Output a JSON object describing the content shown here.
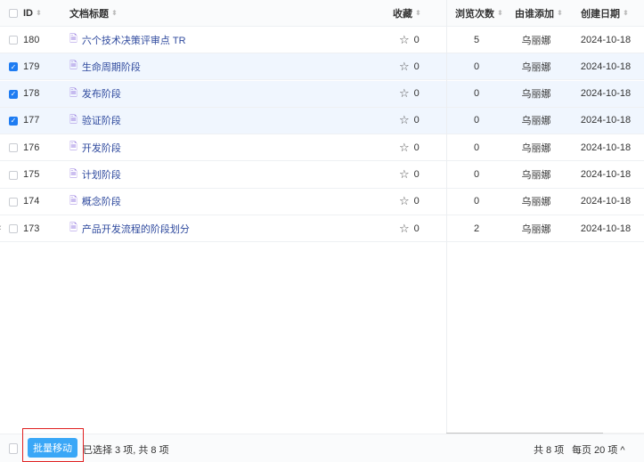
{
  "columns": {
    "id": "ID",
    "title": "文档标题",
    "fav": "收藏",
    "views": "浏览次数",
    "by": "由谁添加",
    "date": "创建日期"
  },
  "rows": [
    {
      "id": "180",
      "title": "六个技术决策评审点 TR",
      "fav": "0",
      "views": "5",
      "by": "乌丽娜",
      "date": "2024-10-18",
      "checked": false
    },
    {
      "id": "179",
      "title": "生命周期阶段",
      "fav": "0",
      "views": "0",
      "by": "乌丽娜",
      "date": "2024-10-18",
      "checked": true
    },
    {
      "id": "178",
      "title": "发布阶段",
      "fav": "0",
      "views": "0",
      "by": "乌丽娜",
      "date": "2024-10-18",
      "checked": true
    },
    {
      "id": "177",
      "title": "验证阶段",
      "fav": "0",
      "views": "0",
      "by": "乌丽娜",
      "date": "2024-10-18",
      "checked": true
    },
    {
      "id": "176",
      "title": "开发阶段",
      "fav": "0",
      "views": "0",
      "by": "乌丽娜",
      "date": "2024-10-18",
      "checked": false
    },
    {
      "id": "175",
      "title": "计划阶段",
      "fav": "0",
      "views": "0",
      "by": "乌丽娜",
      "date": "2024-10-18",
      "checked": false
    },
    {
      "id": "174",
      "title": "概念阶段",
      "fav": "0",
      "views": "0",
      "by": "乌丽娜",
      "date": "2024-10-18",
      "checked": false
    },
    {
      "id": "173",
      "title": "产品开发流程的阶段划分",
      "fav": "0",
      "views": "2",
      "by": "乌丽娜",
      "date": "2024-10-18",
      "checked": false
    }
  ],
  "footer": {
    "batch_move": "批量移动",
    "selection": "已选择 3 项, 共 8 项",
    "total": "共 8 项",
    "per_page": "每页 20 项"
  }
}
